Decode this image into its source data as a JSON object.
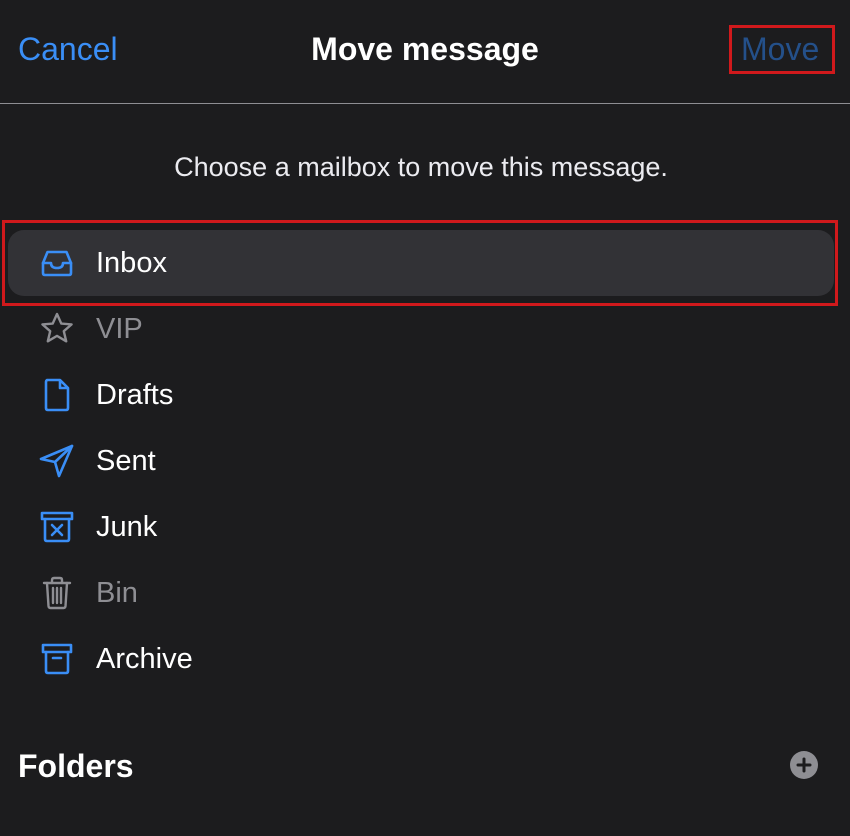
{
  "header": {
    "cancel_label": "Cancel",
    "title": "Move message",
    "move_label": "Move"
  },
  "subtitle": "Choose a mailbox to move this message.",
  "mailboxes": [
    {
      "label": "Inbox",
      "icon": "inbox-icon",
      "selected": true,
      "enabled": true
    },
    {
      "label": "VIP",
      "icon": "star-icon",
      "selected": false,
      "enabled": false
    },
    {
      "label": "Drafts",
      "icon": "document-icon",
      "selected": false,
      "enabled": true
    },
    {
      "label": "Sent",
      "icon": "paper-plane-icon",
      "selected": false,
      "enabled": true
    },
    {
      "label": "Junk",
      "icon": "junk-bin-icon",
      "selected": false,
      "enabled": true
    },
    {
      "label": "Bin",
      "icon": "trash-icon",
      "selected": false,
      "enabled": false
    },
    {
      "label": "Archive",
      "icon": "archive-box-icon",
      "selected": false,
      "enabled": true
    }
  ],
  "folders": {
    "title": "Folders",
    "add_icon": "plus-circle-icon"
  },
  "colors": {
    "background": "#1c1c1e",
    "accent": "#3a8ef6",
    "move_disabled": "#24508a",
    "selected_row": "#323236",
    "disabled_text": "#8e8e93",
    "highlight_box": "#d0191c"
  }
}
